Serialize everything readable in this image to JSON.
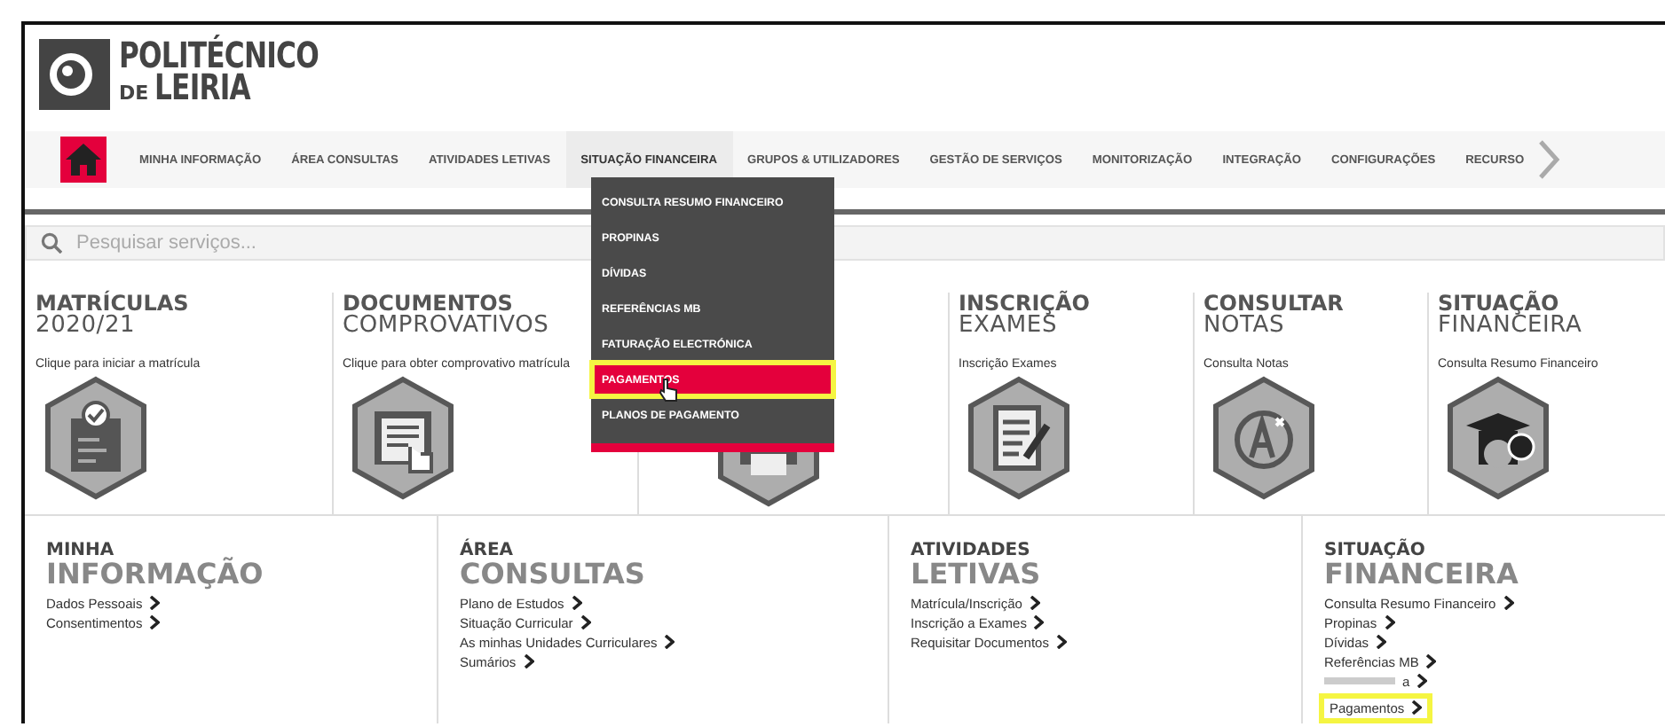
{
  "logo": {
    "line1": "POLITÉCNICO",
    "line2_small": "DE",
    "line2": "LEIRIA"
  },
  "nav": {
    "home_selected": true,
    "items": [
      {
        "label": "MINHA INFORMAÇÃO",
        "selected": false
      },
      {
        "label": "ÁREA CONSULTAS",
        "selected": false
      },
      {
        "label": "ATIVIDADES LETIVAS",
        "selected": false
      },
      {
        "label": "SITUAÇÃO FINANCEIRA",
        "selected": true
      },
      {
        "label": "GRUPOS & UTILIZADORES",
        "selected": false
      },
      {
        "label": "GESTÃO DE SERVIÇOS",
        "selected": false
      },
      {
        "label": "MONITORIZAÇÃO",
        "selected": false
      },
      {
        "label": "INTEGRAÇÃO",
        "selected": false
      },
      {
        "label": "CONFIGURAÇÕES",
        "selected": false
      },
      {
        "label": "RECURSO",
        "selected": false
      }
    ]
  },
  "dropdown": {
    "items": [
      {
        "label": "CONSULTA RESUMO FINANCEIRO",
        "selected": false,
        "highlighted": false
      },
      {
        "label": "PROPINAS",
        "selected": false,
        "highlighted": false
      },
      {
        "label": "DÍVIDAS",
        "selected": false,
        "highlighted": false
      },
      {
        "label": "REFERÊNCIAS MB",
        "selected": false,
        "highlighted": false
      },
      {
        "label": "FATURAÇÃO ELECTRÓNICA",
        "selected": false,
        "highlighted": false
      },
      {
        "label": "PAGAMENTOS",
        "selected": true,
        "highlighted": true
      },
      {
        "label": "PLANOS DE PAGAMENTO",
        "selected": false,
        "highlighted": false
      }
    ]
  },
  "search": {
    "placeholder": "Pesquisar serviços..."
  },
  "tiles": [
    {
      "title": "MATRÍCULAS",
      "subtitle": "2020/21",
      "description": "Clique para iniciar a matrícula",
      "kind": "form"
    },
    {
      "title": "DOCUMENTOS",
      "subtitle": "COMPROVATIVOS",
      "description": "Clique para obter comprovativo matrícula",
      "kind": "document"
    },
    {
      "kind": "printer"
    },
    {
      "title": "INSCRIÇÃO",
      "subtitle": "EXAMES",
      "description": "Inscrição Exames",
      "kind": "edit"
    },
    {
      "title": "CONSULTAR",
      "subtitle": "NOTAS",
      "description": "Consulta Notas",
      "kind": "grade"
    },
    {
      "title": "SITUAÇÃO",
      "subtitle": "FINANCEIRA",
      "description": "Consulta Resumo Financeiro",
      "kind": "cap"
    }
  ],
  "sections": [
    {
      "title": "MINHA",
      "subtitle": "INFORMAÇÃO",
      "links": [
        {
          "label": "Dados Pessoais",
          "highlighted": false
        },
        {
          "label": "Consentimentos",
          "highlighted": false
        }
      ]
    },
    {
      "title": "ÁREA",
      "subtitle": "CONSULTAS",
      "links": [
        {
          "label": "Plano de Estudos",
          "highlighted": false
        },
        {
          "label": "Situação Curricular",
          "highlighted": false
        },
        {
          "label": "As minhas Unidades Curriculares",
          "highlighted": false
        },
        {
          "label": "Sumários",
          "highlighted": false
        }
      ]
    },
    {
      "title": "ATIVIDADES",
      "subtitle": "LETIVAS",
      "links": [
        {
          "label": "Matrícula/Inscrição",
          "highlighted": false
        },
        {
          "label": "Inscrição a Exames",
          "highlighted": false
        },
        {
          "label": "Requisitar Documentos",
          "highlighted": false
        }
      ]
    },
    {
      "title": "SITUAÇÃO",
      "subtitle": "FINANCEIRA",
      "links": [
        {
          "label": "Consulta Resumo Financeiro",
          "highlighted": false
        },
        {
          "label": "Propinas",
          "highlighted": false
        },
        {
          "label": "Dívidas",
          "highlighted": false
        },
        {
          "label": "Referências MB",
          "highlighted": false
        },
        {
          "label": "a",
          "highlighted": false,
          "obscured": true
        },
        {
          "label": "Pagamentos",
          "highlighted": true
        }
      ]
    }
  ]
}
